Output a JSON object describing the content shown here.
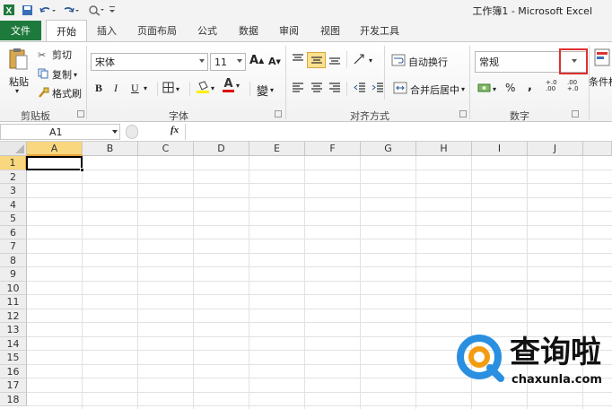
{
  "app": {
    "window_title": "工作簿1 - Microsoft Excel"
  },
  "tabs": {
    "file": "文件",
    "home": "开始",
    "insert": "插入",
    "page_layout": "页面布局",
    "formulas": "公式",
    "data": "数据",
    "review": "审阅",
    "view": "视图",
    "developer": "开发工具"
  },
  "clipboard": {
    "paste": "粘贴",
    "cut": "剪切",
    "copy": "复制",
    "format_painter": "格式刷",
    "group_label": "剪贴板"
  },
  "font": {
    "name": "宋体",
    "size": "11",
    "bold": "B",
    "italic": "I",
    "underline": "U",
    "font_color_letter": "A",
    "grow": "A",
    "shrink": "A",
    "phonetic": "變",
    "group_label": "字体"
  },
  "alignment": {
    "wrap_text": "自动换行",
    "merge_center": "合并后居中",
    "group_label": "对齐方式"
  },
  "number": {
    "format": "常规",
    "percent": "%",
    "comma": ",",
    "increase_decimal": "+.0 .00",
    "decrease_decimal": ".00 +.0",
    "group_label": "数字"
  },
  "styles": {
    "conditional_format": "条件格"
  },
  "formula_bar": {
    "name_box": "A1",
    "fx": "fx",
    "value": ""
  },
  "sheet": {
    "columns": [
      "A",
      "B",
      "C",
      "D",
      "E",
      "F",
      "G",
      "H",
      "I",
      "J"
    ],
    "rows": [
      "1",
      "2",
      "3",
      "4",
      "5",
      "6",
      "7",
      "8",
      "9",
      "10",
      "11",
      "12",
      "13",
      "14",
      "15",
      "16",
      "17",
      "18"
    ],
    "active_cell": "A1"
  },
  "watermark": {
    "brand": "查询啦",
    "domain": "chaxunla.com"
  },
  "colors": {
    "file_tab": "#1e7a3c",
    "highlight_box": "#e03030",
    "selected_cell_border": "#000000",
    "watermark_blue": "#2a8fe0",
    "watermark_orange": "#f39c12"
  }
}
